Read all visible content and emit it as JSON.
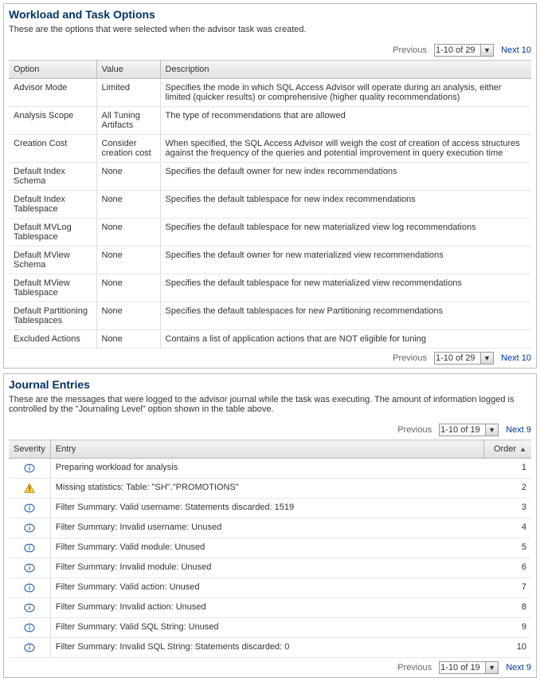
{
  "workload": {
    "title": "Workload and Task Options",
    "desc": "These are the options that were selected when the advisor task was created.",
    "headers": {
      "option": "Option",
      "value": "Value",
      "desc": "Description"
    },
    "rows": [
      {
        "option": "Advisor Mode",
        "value": "Limited",
        "desc": "Specifies the mode in which SQL Access Advisor will operate during an analysis, either limited (quicker results) or comprehensive (higher quality recommendations)"
      },
      {
        "option": "Analysis Scope",
        "value": "All Tuning Artifacts",
        "desc": "The type of recommendations that are allowed"
      },
      {
        "option": "Creation Cost",
        "value": "Consider creation cost",
        "desc": "When specified, the SQL Access Advisor will weigh the cost of creation of access structures against the frequency of the queries and potential improvement in query execution time"
      },
      {
        "option": "Default Index Schema",
        "value": "None",
        "desc": "Specifies the default owner for new index recommendations"
      },
      {
        "option": "Default Index Tablespace",
        "value": "None",
        "desc": "Specifies the default tablespace for new index recommendations"
      },
      {
        "option": "Default MVLog Tablespace",
        "value": "None",
        "desc": "Specifies the default tablespace for new materialized view log recommendations"
      },
      {
        "option": "Default MView Schema",
        "value": "None",
        "desc": "Specifies the default owner for new materialized view recommendations"
      },
      {
        "option": "Default MView Tablespace",
        "value": "None",
        "desc": "Specifies the default tablespace for new materialized view recommendations"
      },
      {
        "option": "Default Partitioning Tablespaces",
        "value": "None",
        "desc": "Specifies the default tablespaces for new Partitioning recommendations"
      },
      {
        "option": "Excluded Actions",
        "value": "None",
        "desc": "Contains a list of application actions that are NOT eligible for tuning"
      }
    ],
    "pager": {
      "prev": "Previous",
      "range": "1-10 of 29",
      "next": "Next 10"
    }
  },
  "journal": {
    "title": "Journal Entries",
    "desc": "These are the messages that were logged to the advisor journal while the task was executing. The amount of information logged is controlled by the \"Journaling Level\" option shown in the table above.",
    "headers": {
      "severity": "Severity",
      "entry": "Entry",
      "order": "Order"
    },
    "rows": [
      {
        "sev": "info",
        "entry": "Preparing workload for analysis",
        "order": "1"
      },
      {
        "sev": "warn",
        "entry": "Missing statistics: Table: \"SH\".\"PROMOTIONS\"",
        "order": "2"
      },
      {
        "sev": "info",
        "entry": "Filter Summary: Valid username: Statements discarded: 1519",
        "order": "3"
      },
      {
        "sev": "info",
        "entry": "Filter Summary: Invalid username: Unused",
        "order": "4"
      },
      {
        "sev": "info",
        "entry": "Filter Summary: Valid module: Unused",
        "order": "5"
      },
      {
        "sev": "info",
        "entry": "Filter Summary: Invalid module: Unused",
        "order": "6"
      },
      {
        "sev": "info",
        "entry": "Filter Summary: Valid action: Unused",
        "order": "7"
      },
      {
        "sev": "info",
        "entry": "Filter Summary: Invalid action: Unused",
        "order": "8"
      },
      {
        "sev": "info",
        "entry": "Filter Summary: Valid SQL String: Unused",
        "order": "9"
      },
      {
        "sev": "info",
        "entry": "Filter Summary: Invalid SQL String: Statements discarded: 0",
        "order": "10"
      }
    ],
    "pager": {
      "prev": "Previous",
      "range": "1-10 of 19",
      "next": "Next 9"
    }
  }
}
